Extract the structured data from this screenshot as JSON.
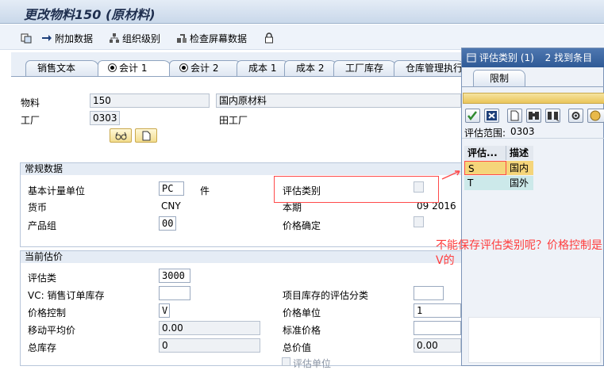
{
  "window": {
    "title": "更改物料150 (原材料)"
  },
  "toolbar": {
    "items": [
      {
        "label": "附加数据",
        "icon": "arrow-right-icon"
      },
      {
        "label": "组织级别",
        "icon": "org-levels-icon"
      },
      {
        "label": "检查屏幕数据",
        "icon": "check-screen-icon"
      },
      {
        "label": "",
        "icon": "lock-icon"
      }
    ]
  },
  "tabs": [
    "销售文本",
    "会计 1",
    "会计 2",
    "成本 1",
    "成本 2",
    "工厂库存",
    "仓库管理执行"
  ],
  "header": {
    "material_label": "物料",
    "material_value": "150",
    "material_desc": "国内原材料",
    "plant_label": "工厂",
    "plant_value": "0303",
    "plant_desc": "田工厂"
  },
  "general": {
    "title": "常规数据",
    "base_uom_label": "基本计量单位",
    "base_uom": "PC",
    "base_uom_text": "件",
    "val_category_label": "评估类别",
    "currency_label": "货币",
    "currency": "CNY",
    "period_label": "本期",
    "period": "09 2016",
    "prod_group_label": "产品组",
    "prod_group": "00",
    "price_det_label": "价格确定"
  },
  "current": {
    "title": "当前估价",
    "val_class_label": "评估类",
    "val_class": "3000",
    "vc_label": "VC: 销售订单库存",
    "proj_label": "项目库存的评估分类",
    "price_ctrl_label": "价格控制",
    "price_ctrl": "V",
    "price_unit_label": "价格单位",
    "price_unit": "1",
    "map_label": "移动平均价",
    "map_value": "0.00",
    "std_price_label": "标准价格",
    "total_stock_label": "总库存",
    "total_stock": "0",
    "total_value_label": "总价值",
    "total_value": "0.00",
    "val_unit_label": "评估单位"
  },
  "popup": {
    "title": "评估类别 (1)",
    "found": "2 找到条目",
    "tab": "限制",
    "scope_label": "评估范围:",
    "scope_value": "0303",
    "col1": "评估...",
    "col2": "描述",
    "rows": [
      {
        "code": "S",
        "desc": "国内"
      },
      {
        "code": "T",
        "desc": "国外"
      }
    ]
  },
  "annotation": {
    "text": "不能保存评估类别呢？价格控制是V的",
    "color": "#ff3c3c"
  }
}
